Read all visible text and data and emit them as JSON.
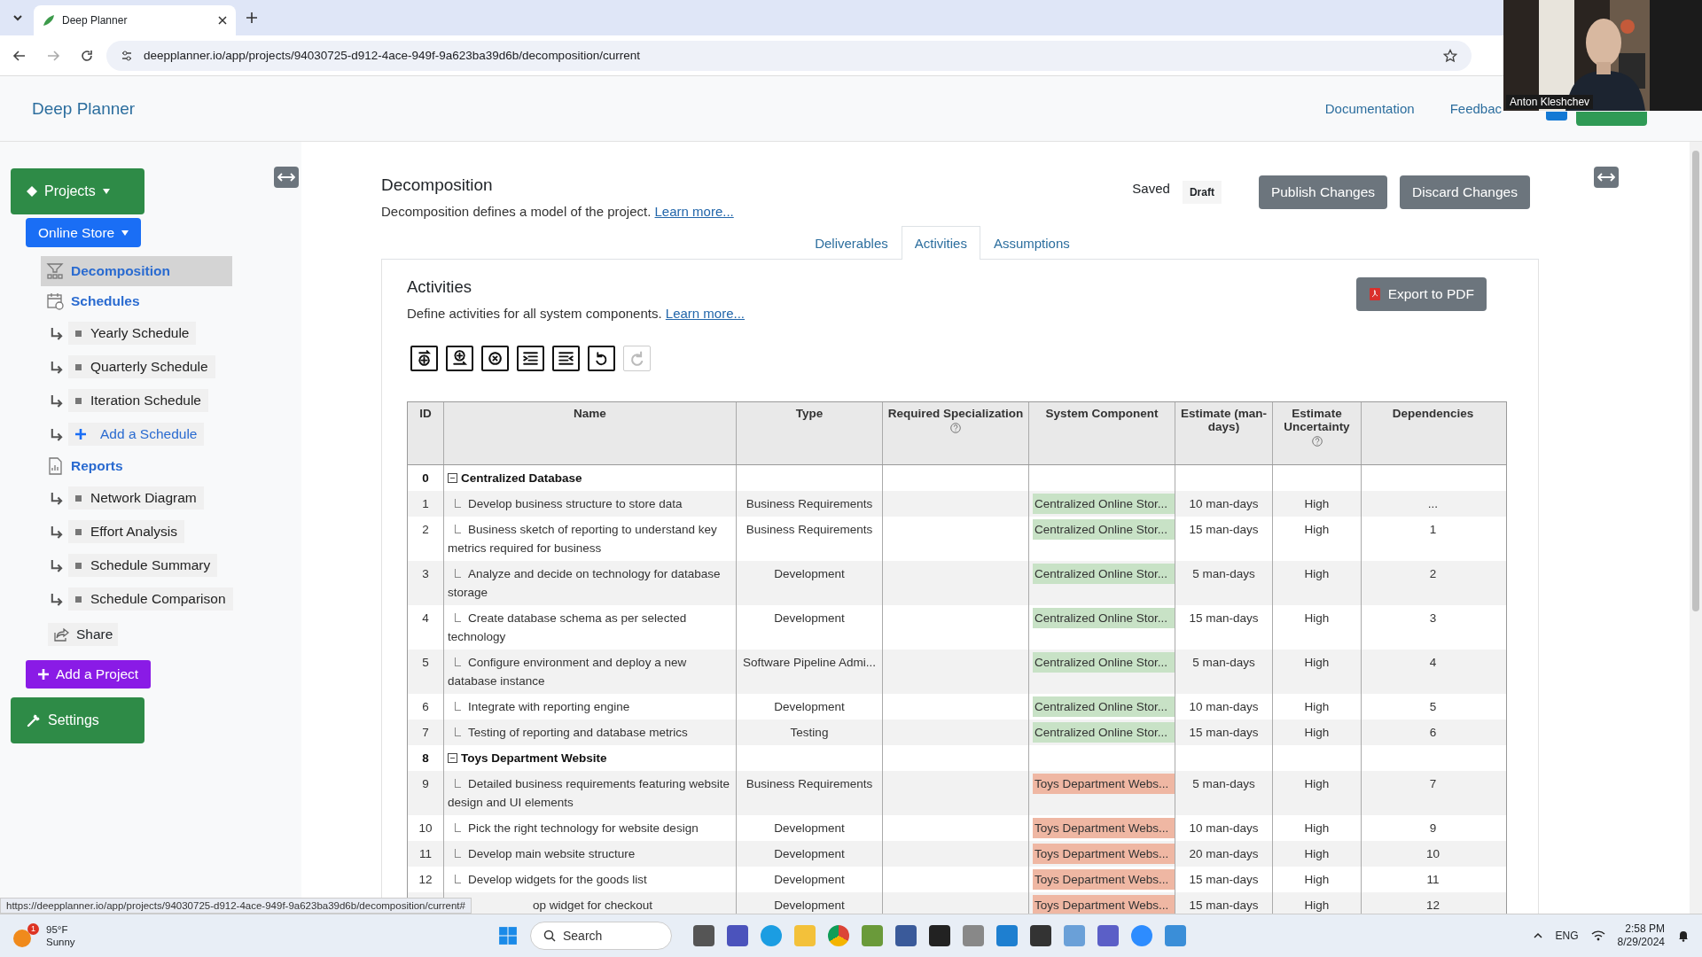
{
  "browser": {
    "tab_title": "Deep Planner",
    "url": "deepplanner.io/app/projects/94030725-d912-4ace-949f-9a623ba39d6b/decomposition/current"
  },
  "webcam": {
    "name": "Anton Kleshchev"
  },
  "header": {
    "brand": "Deep Planner",
    "links": [
      "Documentation",
      "Feedbac"
    ]
  },
  "sidebar": {
    "projects_button": "Projects",
    "project_button": "Online Store",
    "sections": [
      {
        "label": "Decomposition",
        "kind": "decomposition",
        "selected": true
      },
      {
        "label": "Schedules",
        "kind": "schedules",
        "selected": false,
        "children": [
          {
            "label": "Yearly Schedule",
            "kind": "item"
          },
          {
            "label": "Quarterly Schedule",
            "kind": "item"
          },
          {
            "label": "Iteration Schedule",
            "kind": "item"
          },
          {
            "label": "Add a Schedule",
            "kind": "add"
          }
        ]
      },
      {
        "label": "Reports",
        "kind": "reports",
        "selected": false,
        "children": [
          {
            "label": "Network Diagram",
            "kind": "item"
          },
          {
            "label": "Effort Analysis",
            "kind": "item"
          },
          {
            "label": "Schedule Summary",
            "kind": "item"
          },
          {
            "label": "Schedule Comparison",
            "kind": "item"
          }
        ]
      }
    ],
    "share": "Share",
    "add_project": "Add a Project",
    "settings": "Settings"
  },
  "page": {
    "title": "Decomposition",
    "description": "Decomposition defines a model of the project.",
    "learn_more": "Learn more...",
    "status": "Saved",
    "badge": "Draft",
    "buttons": [
      "Publish Changes",
      "Discard Changes"
    ]
  },
  "tabs": [
    {
      "label": "Deliverables",
      "selected": false
    },
    {
      "label": "Activities",
      "selected": true
    },
    {
      "label": "Assumptions",
      "selected": false
    }
  ],
  "panel": {
    "title": "Activities",
    "description": "Define activities for all system components.",
    "learn_more": "Learn more...",
    "export": "Export to PDF"
  },
  "toolbar": [
    {
      "kind": "add-next",
      "disabled": false
    },
    {
      "kind": "add-child",
      "disabled": false
    },
    {
      "kind": "delete",
      "disabled": false
    },
    {
      "kind": "indent",
      "disabled": false
    },
    {
      "kind": "outdent",
      "disabled": false
    },
    {
      "kind": "undo",
      "disabled": false
    },
    {
      "kind": "redo",
      "disabled": true
    }
  ],
  "table": {
    "columns": [
      {
        "label": "ID"
      },
      {
        "label": "Name"
      },
      {
        "label": "Type"
      },
      {
        "label": "Required Specialization",
        "help": true
      },
      {
        "label": "System Component"
      },
      {
        "label": "Estimate (man-days)"
      },
      {
        "label": "Estimate Uncertainty",
        "help": true
      },
      {
        "label": "Dependencies"
      }
    ],
    "rows": [
      {
        "kind": "group",
        "id": "0",
        "name": "Centralized Database",
        "expanded": true
      },
      {
        "kind": "task",
        "id": "1",
        "name": "Develop business structure to store data",
        "type": "Business Requirements",
        "component": "Centralized Online Stor...",
        "color": "#c8e2c6",
        "estimate": "10 man-days",
        "uncertainty": "High",
        "dependencies": "..."
      },
      {
        "kind": "task",
        "id": "2",
        "name": "Business sketch of reporting to understand key metrics required for business",
        "type": "Business Requirements",
        "component": "Centralized Online Stor...",
        "color": "#c8e2c6",
        "estimate": "15 man-days",
        "uncertainty": "High",
        "dependencies": "1"
      },
      {
        "kind": "task",
        "id": "3",
        "name": "Analyze and decide on technology for database storage",
        "type": "Development",
        "component": "Centralized Online Stor...",
        "color": "#c8e2c6",
        "estimate": "5 man-days",
        "uncertainty": "High",
        "dependencies": "2"
      },
      {
        "kind": "task",
        "id": "4",
        "name": "Create database schema as per selected technology",
        "type": "Development",
        "component": "Centralized Online Stor...",
        "color": "#c8e2c6",
        "estimate": "15 man-days",
        "uncertainty": "High",
        "dependencies": "3"
      },
      {
        "kind": "task",
        "id": "5",
        "name": "Configure environment and deploy a new database instance",
        "type": "Software Pipeline Admi...",
        "component": "Centralized Online Stor...",
        "color": "#c8e2c6",
        "estimate": "5 man-days",
        "uncertainty": "High",
        "dependencies": "4"
      },
      {
        "kind": "task",
        "id": "6",
        "name": "Integrate with reporting engine",
        "type": "Development",
        "component": "Centralized Online Stor...",
        "color": "#c8e2c6",
        "estimate": "10 man-days",
        "uncertainty": "High",
        "dependencies": "5"
      },
      {
        "kind": "task",
        "id": "7",
        "name": "Testing of reporting and database metrics",
        "type": "Testing",
        "component": "Centralized Online Stor...",
        "color": "#c8e2c6",
        "estimate": "15 man-days",
        "uncertainty": "High",
        "dependencies": "6"
      },
      {
        "kind": "group",
        "id": "8",
        "name": "Toys Department Website",
        "expanded": true
      },
      {
        "kind": "task",
        "id": "9",
        "name": "Detailed business requirements featuring website design and UI elements",
        "type": "Business Requirements",
        "component": "Toys Department Webs...",
        "color": "#efb7a3",
        "estimate": "5 man-days",
        "uncertainty": "High",
        "dependencies": "7"
      },
      {
        "kind": "task",
        "id": "10",
        "name": "Pick the right technology for website design",
        "type": "Development",
        "component": "Toys Department Webs...",
        "color": "#efb7a3",
        "estimate": "10 man-days",
        "uncertainty": "High",
        "dependencies": "9"
      },
      {
        "kind": "task",
        "id": "11",
        "name": "Develop main website structure",
        "type": "Development",
        "component": "Toys Department Webs...",
        "color": "#efb7a3",
        "estimate": "20 man-days",
        "uncertainty": "High",
        "dependencies": "10"
      },
      {
        "kind": "task",
        "id": "12",
        "name": "Develop widgets for the goods list",
        "type": "Development",
        "component": "Toys Department Webs...",
        "color": "#efb7a3",
        "estimate": "15 man-days",
        "uncertainty": "High",
        "dependencies": "11"
      },
      {
        "kind": "covered",
        "name": "op widget for checkout",
        "type": "Development",
        "component": "Toys Department Webs...",
        "color": "#efb7a3",
        "estimate": "15 man-days",
        "uncertainty": "High",
        "dependencies": "12"
      }
    ]
  },
  "link_preview": "https://deepplanner.io/app/projects/94030725-d912-4ace-949f-9a623ba39d6b/decomposition/current#",
  "taskbar": {
    "temperature": "95°F",
    "weather": "Sunny",
    "weather_badge": "1",
    "search": "Search",
    "language": "ENG",
    "time": "2:58 PM",
    "date": "8/29/2024"
  }
}
